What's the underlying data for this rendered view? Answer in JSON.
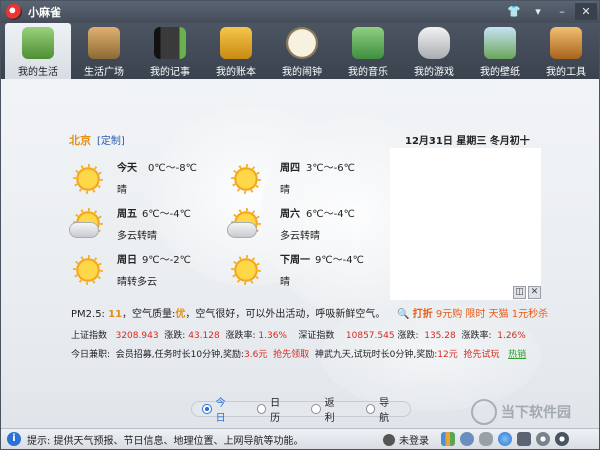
{
  "app": {
    "title": "小麻雀"
  },
  "toolbar": {
    "items": [
      {
        "label": "我的生活",
        "icon": "house-icon",
        "color": "#6aa84f"
      },
      {
        "label": "生活广场",
        "icon": "village-icon",
        "color": "#c78c3c"
      },
      {
        "label": "我的记事",
        "icon": "notebook-icon",
        "color": "#3a3a3a"
      },
      {
        "label": "我的账本",
        "icon": "money-book-icon",
        "color": "#e1a72a"
      },
      {
        "label": "我的闹钟",
        "icon": "clock-icon",
        "color": "#d9c9a0"
      },
      {
        "label": "我的音乐",
        "icon": "music-icon",
        "color": "#6fa86a"
      },
      {
        "label": "我的游戏",
        "icon": "gamepad-icon",
        "color": "#dcdcdc"
      },
      {
        "label": "我的壁纸",
        "icon": "wallpaper-icon",
        "color": "#7aa86b"
      },
      {
        "label": "我的工具",
        "icon": "tools-icon",
        "color": "#d89a3c"
      }
    ]
  },
  "weather": {
    "city": "北京",
    "custom_link": "[定制]",
    "days": [
      {
        "name": "今天",
        "temp": "0℃～-8℃",
        "desc": "晴",
        "icon": "sun-icon"
      },
      {
        "name": "周四",
        "temp": "3℃～-6℃",
        "desc": "晴",
        "icon": "sun-icon"
      },
      {
        "name": "周五",
        "temp": "6℃～-4℃",
        "desc": "多云转晴",
        "icon": "partly-cloudy-icon"
      },
      {
        "name": "周六",
        "temp": "6℃～-4℃",
        "desc": "多云转晴",
        "icon": "partly-cloudy-icon"
      },
      {
        "name": "周日",
        "temp": "9℃～-2℃",
        "desc": "晴转多云",
        "icon": "sun-icon"
      },
      {
        "name": "下周一",
        "temp": "9℃～-4℃",
        "desc": "晴",
        "icon": "sun-icon"
      }
    ]
  },
  "date": {
    "text": "12月31日 星期三 冬月初十"
  },
  "air": {
    "prefix": "PM2.5:",
    "value": "11",
    "quality_label": "，空气质量:",
    "quality": "优",
    "advice": "，空气很好，可以外出活动，呼吸新鲜空气。"
  },
  "promo": {
    "tag": "打折",
    "text": "9元购 限时 天猫 1元秒杀"
  },
  "stocks": {
    "sh_label": "上证指数",
    "sh_value": "3208.943",
    "sh_change_label": "涨跌:",
    "sh_change": "43.128",
    "sh_rate_label": "涨跌率:",
    "sh_rate": "1.36%",
    "sz_label": "深证指数",
    "sz_value": "10857.545",
    "sz_change_label": "涨跌:",
    "sz_change": "135.28",
    "sz_rate_label": "涨跌率:",
    "sz_rate": "1.26%"
  },
  "news": {
    "label": "今日兼职:",
    "item1": "会员招募,任务时长10分钟,奖励:",
    "reward1": "3.6元",
    "action1": "抢先领取",
    "item2": "神武九天,试玩时长0分钟,奖励:",
    "reward2": "12元",
    "action2": "抢先试玩",
    "more": "热销"
  },
  "bottom_tabs": [
    {
      "label": "今日",
      "selected": true
    },
    {
      "label": "日历",
      "selected": false
    },
    {
      "label": "返利",
      "selected": false
    },
    {
      "label": "导航",
      "selected": false
    }
  ],
  "watermark": {
    "text": "当下软件园"
  },
  "status": {
    "hint": "提示: 提供天气预报、节日信息、地理位置、上网导航等功能。",
    "login": "未登录"
  },
  "colors": {
    "accent": "#e0901a",
    "link": "#2a5db0",
    "red": "#d8281d",
    "selected": "#2a72d4"
  }
}
